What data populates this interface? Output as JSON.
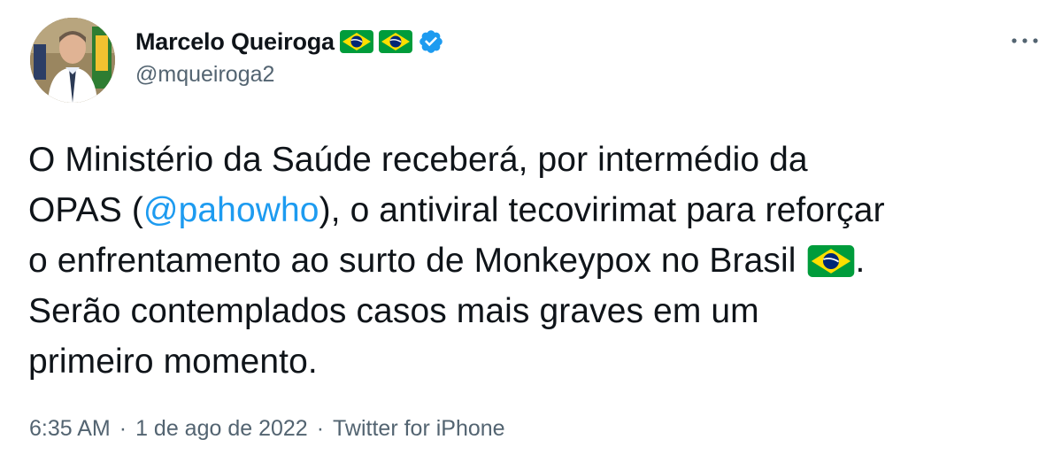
{
  "author": {
    "display_name": "Marcelo Queiroga",
    "name_emojis": [
      "brazil-flag",
      "brazil-flag"
    ],
    "verified": true,
    "handle": "@mqueiroga2"
  },
  "tweet": {
    "line1": "O Ministério da Saúde receberá, por intermédio da",
    "line2_pre": "OPAS (",
    "mention": "@pahowho",
    "line2_post": "), o antiviral tecovirimat para reforçar",
    "line3_pre": "o enfrentamento ao surto de Monkeypox no Brasil ",
    "line3_post": ".",
    "line4": "Serão contemplados casos mais graves em um",
    "line5": "primeiro momento."
  },
  "meta": {
    "time": "6:35 AM",
    "separator": "·",
    "date": "1 de ago de 2022",
    "source": "Twitter for iPhone"
  },
  "colors": {
    "text": "#0f1419",
    "secondary": "#536471",
    "link": "#1d9bf0",
    "verified_badge": "#1d9bf0"
  }
}
